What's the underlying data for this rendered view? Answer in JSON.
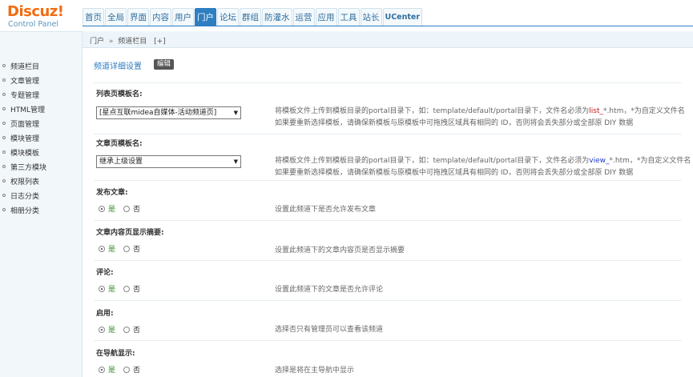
{
  "brand": {
    "name": "Discuz!",
    "subtitle": "Control Panel"
  },
  "nav": [
    {
      "label": "首页"
    },
    {
      "label": "全局"
    },
    {
      "label": "界面"
    },
    {
      "label": "内容"
    },
    {
      "label": "用户"
    },
    {
      "label": "门户",
      "active": true
    },
    {
      "label": "论坛"
    },
    {
      "label": "群组"
    },
    {
      "label": "防灌水"
    },
    {
      "label": "运营"
    },
    {
      "label": "应用"
    },
    {
      "label": "工具"
    },
    {
      "label": "站长"
    },
    {
      "label": "UCenter"
    }
  ],
  "breadcrumb": {
    "root": "门户",
    "sep": "»",
    "current": "频道栏目",
    "add": "[+]"
  },
  "sidebar": {
    "items": [
      {
        "label": "频道栏目"
      },
      {
        "label": "文章管理"
      },
      {
        "label": "专题管理"
      },
      {
        "label": "HTML管理"
      },
      {
        "label": "页面管理"
      },
      {
        "label": "模块管理"
      },
      {
        "label": "模块模板"
      },
      {
        "label": "第三方模块"
      },
      {
        "label": "权限列表"
      },
      {
        "label": "日志分类"
      },
      {
        "label": "相册分类"
      }
    ]
  },
  "main": {
    "section_title": "频道详细设置",
    "edit_label": "编辑",
    "list_tpl": {
      "label": "列表页模板名:",
      "value": "[星点互联midea自媒体-活动频道页]",
      "tip1_a": "将模板文件上传到模板目录的portal目录下，如：template/default/portal目录下，文件名必须为",
      "tip1_hl": "list_",
      "tip1_b": "*.htm，*为自定义文件名",
      "tip2": "如果要重新选择模板，请确保新模板与原模板中可拖拽区域具有相同的 ID，否则将会丢失部分或全部原 DIY 数据"
    },
    "article_tpl": {
      "label": "文章页模板名:",
      "value": "继承上级设置",
      "tip1_a": "将模板文件上传到模板目录的portal目录下，如：template/default/portal目录下，文件名必须为",
      "tip1_hl": "view_",
      "tip1_b": "*.htm，*为自定义文件名",
      "tip2": "如果要重新选择模板，请确保新模板与原模板中可拖拽区域具有相同的 ID，否则将会丢失部分或全部原 DIY 数据"
    },
    "radio_yes": "是",
    "radio_no": "否",
    "fields": [
      {
        "label": "发布文章:",
        "tip": "设置此频道下是否允许发布文章"
      },
      {
        "label": "文章内容页显示摘要:",
        "tip": "设置此频道下的文章内容页是否显示摘要"
      },
      {
        "label": "评论:",
        "tip": "设置此频道下的文章是否允许评论"
      },
      {
        "label": "启用:",
        "tip": "选择否只有管理员可以查看该频道"
      },
      {
        "label": "在导航显示:",
        "tip": "选择是将在主导航中显示"
      }
    ]
  }
}
